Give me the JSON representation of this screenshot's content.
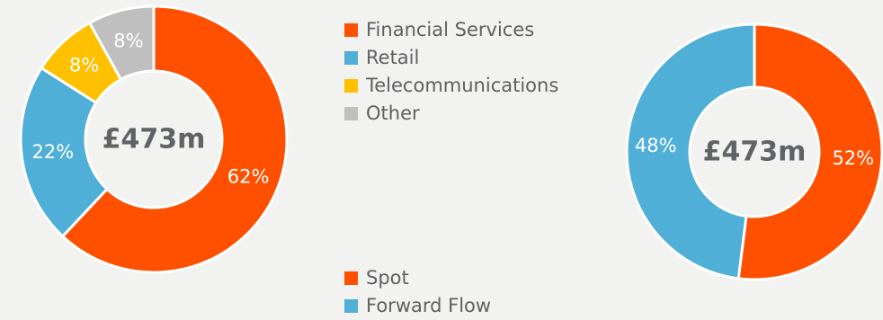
{
  "chart_data": [
    {
      "type": "pie",
      "center_label": "£473m",
      "slices": [
        {
          "label": "Financial Services",
          "value": 62,
          "value_label": "62%",
          "color": "#ff5000"
        },
        {
          "label": "Retail",
          "value": 22,
          "value_label": "22%",
          "color": "#4fafd6"
        },
        {
          "label": "Telecommunications",
          "value": 8,
          "value_label": "8%",
          "color": "#ffc000"
        },
        {
          "label": "Other",
          "value": 8,
          "value_label": "8%",
          "color": "#bfbfbf"
        }
      ],
      "legend_position": "right"
    },
    {
      "type": "pie",
      "center_label": "£473m",
      "slices": [
        {
          "label": "Spot",
          "value": 52,
          "value_label": "52%",
          "color": "#ff5000"
        },
        {
          "label": "Forward Flow",
          "value": 48,
          "value_label": "48%",
          "color": "#4fafd6"
        }
      ],
      "legend_position": "left"
    }
  ]
}
